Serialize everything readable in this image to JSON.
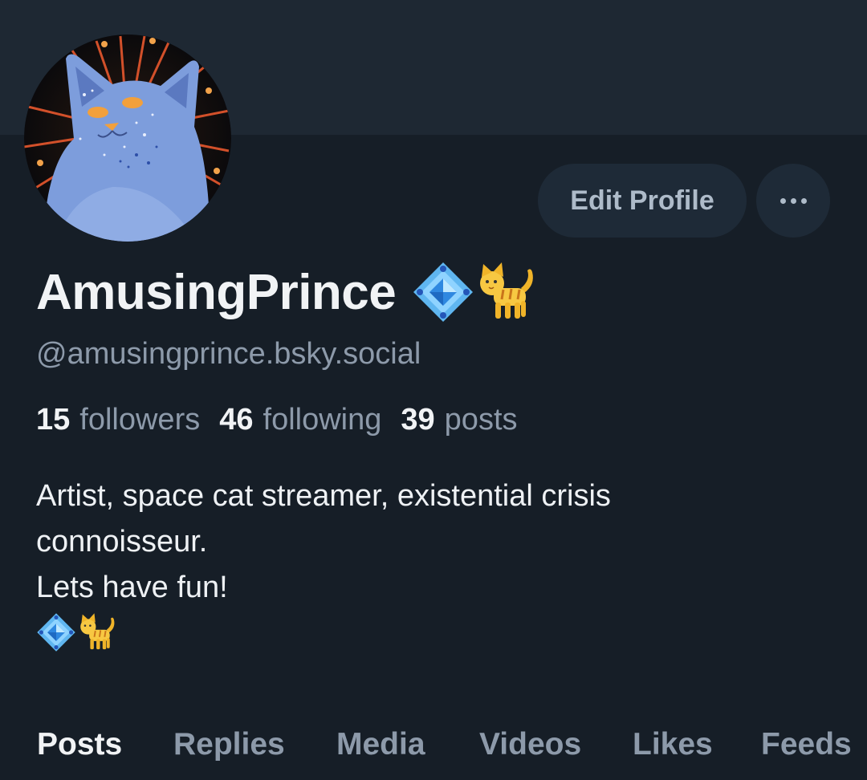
{
  "profile": {
    "display_name": "AmusingPrince",
    "handle": "@amusingprince.bsky.social",
    "name_emojis": [
      "gem-stone-icon",
      "cat-icon"
    ],
    "bio_lines": [
      "Artist, space cat streamer, existential crisis",
      "connoisseur.",
      "Lets have fun!"
    ],
    "bio_emojis": [
      "gem-stone-icon",
      "cat-icon"
    ]
  },
  "actions": {
    "edit_label": "Edit Profile",
    "more_icon": "ellipsis-icon"
  },
  "stats": {
    "followers_count": "15",
    "followers_label": "followers",
    "following_count": "46",
    "following_label": "following",
    "posts_count": "39",
    "posts_label": "posts"
  },
  "tabs": [
    {
      "label": "Posts",
      "active": true
    },
    {
      "label": "Replies",
      "active": false
    },
    {
      "label": "Media",
      "active": false
    },
    {
      "label": "Videos",
      "active": false
    },
    {
      "label": "Likes",
      "active": false
    },
    {
      "label": "Feeds",
      "active": false
    }
  ],
  "colors": {
    "background": "#161e27",
    "banner": "#1e2833",
    "button": "#1e2a37",
    "text_primary": "#f1f3f5",
    "text_secondary": "#8d9aaa"
  }
}
